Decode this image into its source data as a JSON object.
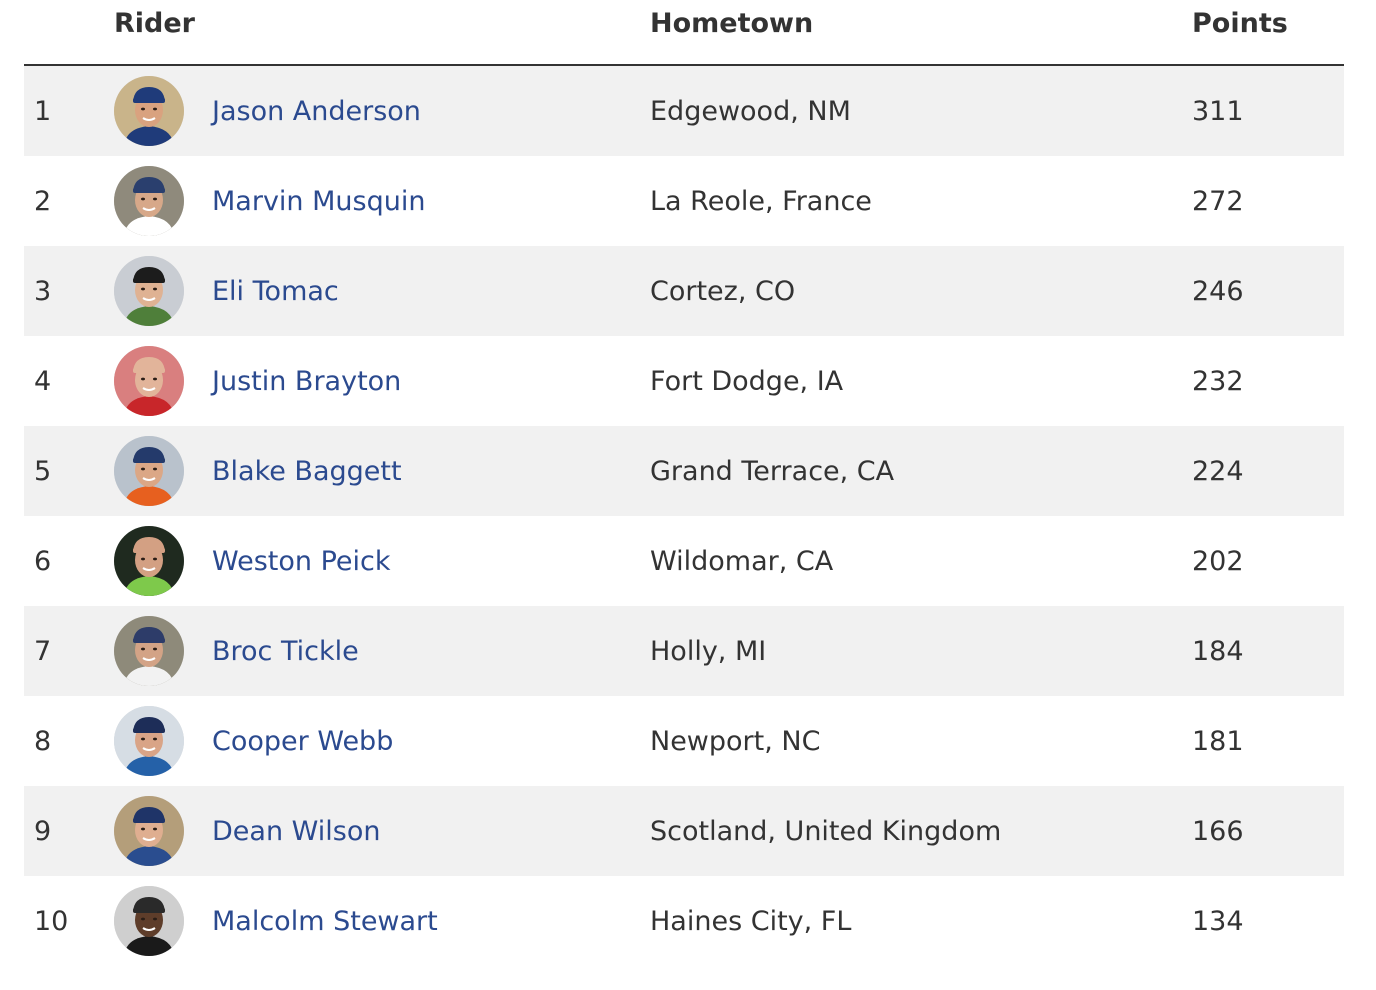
{
  "headers": {
    "rider": "Rider",
    "hometown": "Hometown",
    "points": "Points"
  },
  "rows": [
    {
      "rank": "1",
      "name": "Jason Anderson",
      "hometown": "Edgewood, NM",
      "points": "311",
      "avatar": {
        "bg": "#c9b48a",
        "skin": "#d9a27f",
        "hat": "#1f3b7a",
        "shirt": "#1f3b7a"
      }
    },
    {
      "rank": "2",
      "name": "Marvin Musquin",
      "hometown": "La Reole, France",
      "points": "272",
      "avatar": {
        "bg": "#8f8a7c",
        "skin": "#d7a889",
        "hat": "#2a3f6e",
        "shirt": "#ffffff"
      }
    },
    {
      "rank": "3",
      "name": "Eli Tomac",
      "hometown": "Cortez, CO",
      "points": "246",
      "avatar": {
        "bg": "#c9cdd3",
        "skin": "#dfb293",
        "hat": "#1c1c1c",
        "shirt": "#4f7f3a"
      }
    },
    {
      "rank": "4",
      "name": "Justin Brayton",
      "hometown": "Fort Dodge, IA",
      "points": "232",
      "avatar": {
        "bg": "#d97f7f",
        "skin": "#e2b49a",
        "hat": "#e2b49a",
        "shirt": "#c8262a"
      }
    },
    {
      "rank": "5",
      "name": "Blake Baggett",
      "hometown": "Grand Terrace, CA",
      "points": "224",
      "avatar": {
        "bg": "#b9c2cc",
        "skin": "#dba786",
        "hat": "#243a6b",
        "shirt": "#e7601f"
      }
    },
    {
      "rank": "6",
      "name": "Weston Peick",
      "hometown": "Wildomar, CA",
      "points": "202",
      "avatar": {
        "bg": "#1f2a1f",
        "skin": "#d3a083",
        "hat": "#d3a083",
        "shirt": "#7ec94b"
      }
    },
    {
      "rank": "7",
      "name": "Broc Tickle",
      "hometown": "Holly, MI",
      "points": "184",
      "avatar": {
        "bg": "#8e8a7a",
        "skin": "#d3a386",
        "hat": "#2d3c69",
        "shirt": "#f2f2f2"
      }
    },
    {
      "rank": "8",
      "name": "Cooper Webb",
      "hometown": "Newport, NC",
      "points": "181",
      "avatar": {
        "bg": "#d6dde4",
        "skin": "#d9a487",
        "hat": "#1d2d58",
        "shirt": "#2561a8"
      }
    },
    {
      "rank": "9",
      "name": "Dean Wilson",
      "hometown": "Scotland, United Kingdom",
      "points": "166",
      "avatar": {
        "bg": "#b49e7a",
        "skin": "#dfae90",
        "hat": "#1f3468",
        "shirt": "#2a4d8f"
      }
    },
    {
      "rank": "10",
      "name": "Malcolm Stewart",
      "hometown": "Haines City, FL",
      "points": "134",
      "avatar": {
        "bg": "#cfcfcf",
        "skin": "#5e3d2a",
        "hat": "#2a2a2a",
        "shirt": "#1a1a1a"
      }
    }
  ]
}
